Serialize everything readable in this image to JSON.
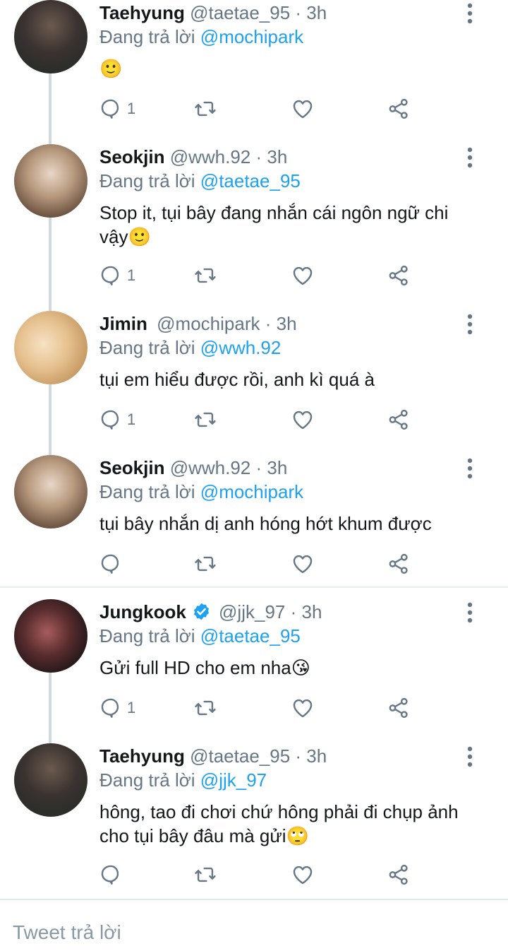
{
  "reply_label": "Đang trả lời",
  "tweets": [
    {
      "name": "Taehyung",
      "handle": "@taetae_95",
      "sep": "·",
      "time": "3h",
      "reply_to": "@mochipark",
      "text": "",
      "emoji": "🙂",
      "reply_count": "1",
      "verified": false
    },
    {
      "name": "Seokjin",
      "handle": "@wwh.92",
      "sep": "·",
      "time": "3h",
      "reply_to": "@taetae_95",
      "text": "Stop it, tụi bây đang nhắn cái ngôn ngữ chi vậy",
      "emoji": "🙂",
      "reply_count": "1",
      "verified": false
    },
    {
      "name": "Jimin",
      "handle": "@mochipark",
      "sep": "·",
      "time": "3h",
      "reply_to": "@wwh.92",
      "text": "tụi em hiểu được rồi, anh kì quá à",
      "emoji": "",
      "reply_count": "1",
      "verified": false
    },
    {
      "name": "Seokjin",
      "handle": "@wwh.92",
      "sep": "·",
      "time": "3h",
      "reply_to": "@mochipark",
      "text": "tụi bây nhắn dị anh hóng hớt khum được",
      "emoji": "",
      "reply_count": "",
      "verified": false
    },
    {
      "name": "Jungkook",
      "handle": "@jjk_97",
      "sep": "·",
      "time": "3h",
      "reply_to": "@taetae_95",
      "text": "Gửi full HD cho em nha",
      "emoji": "😘",
      "reply_count": "1",
      "verified": true
    },
    {
      "name": "Taehyung",
      "handle": "@taetae_95",
      "sep": "·",
      "time": "3h",
      "reply_to": "@jjk_97",
      "text": "hông, tao đi chơi chứ hông phải đi chụp ảnh cho tụi bây đâu mà gửi",
      "emoji": "🙄",
      "reply_count": "",
      "verified": false
    }
  ],
  "reply_bar": {
    "placeholder": "Tweet trả lời"
  },
  "colors": {
    "accent": "#1da1f2",
    "muted": "#657786",
    "thread_line": "#cfd9de"
  }
}
